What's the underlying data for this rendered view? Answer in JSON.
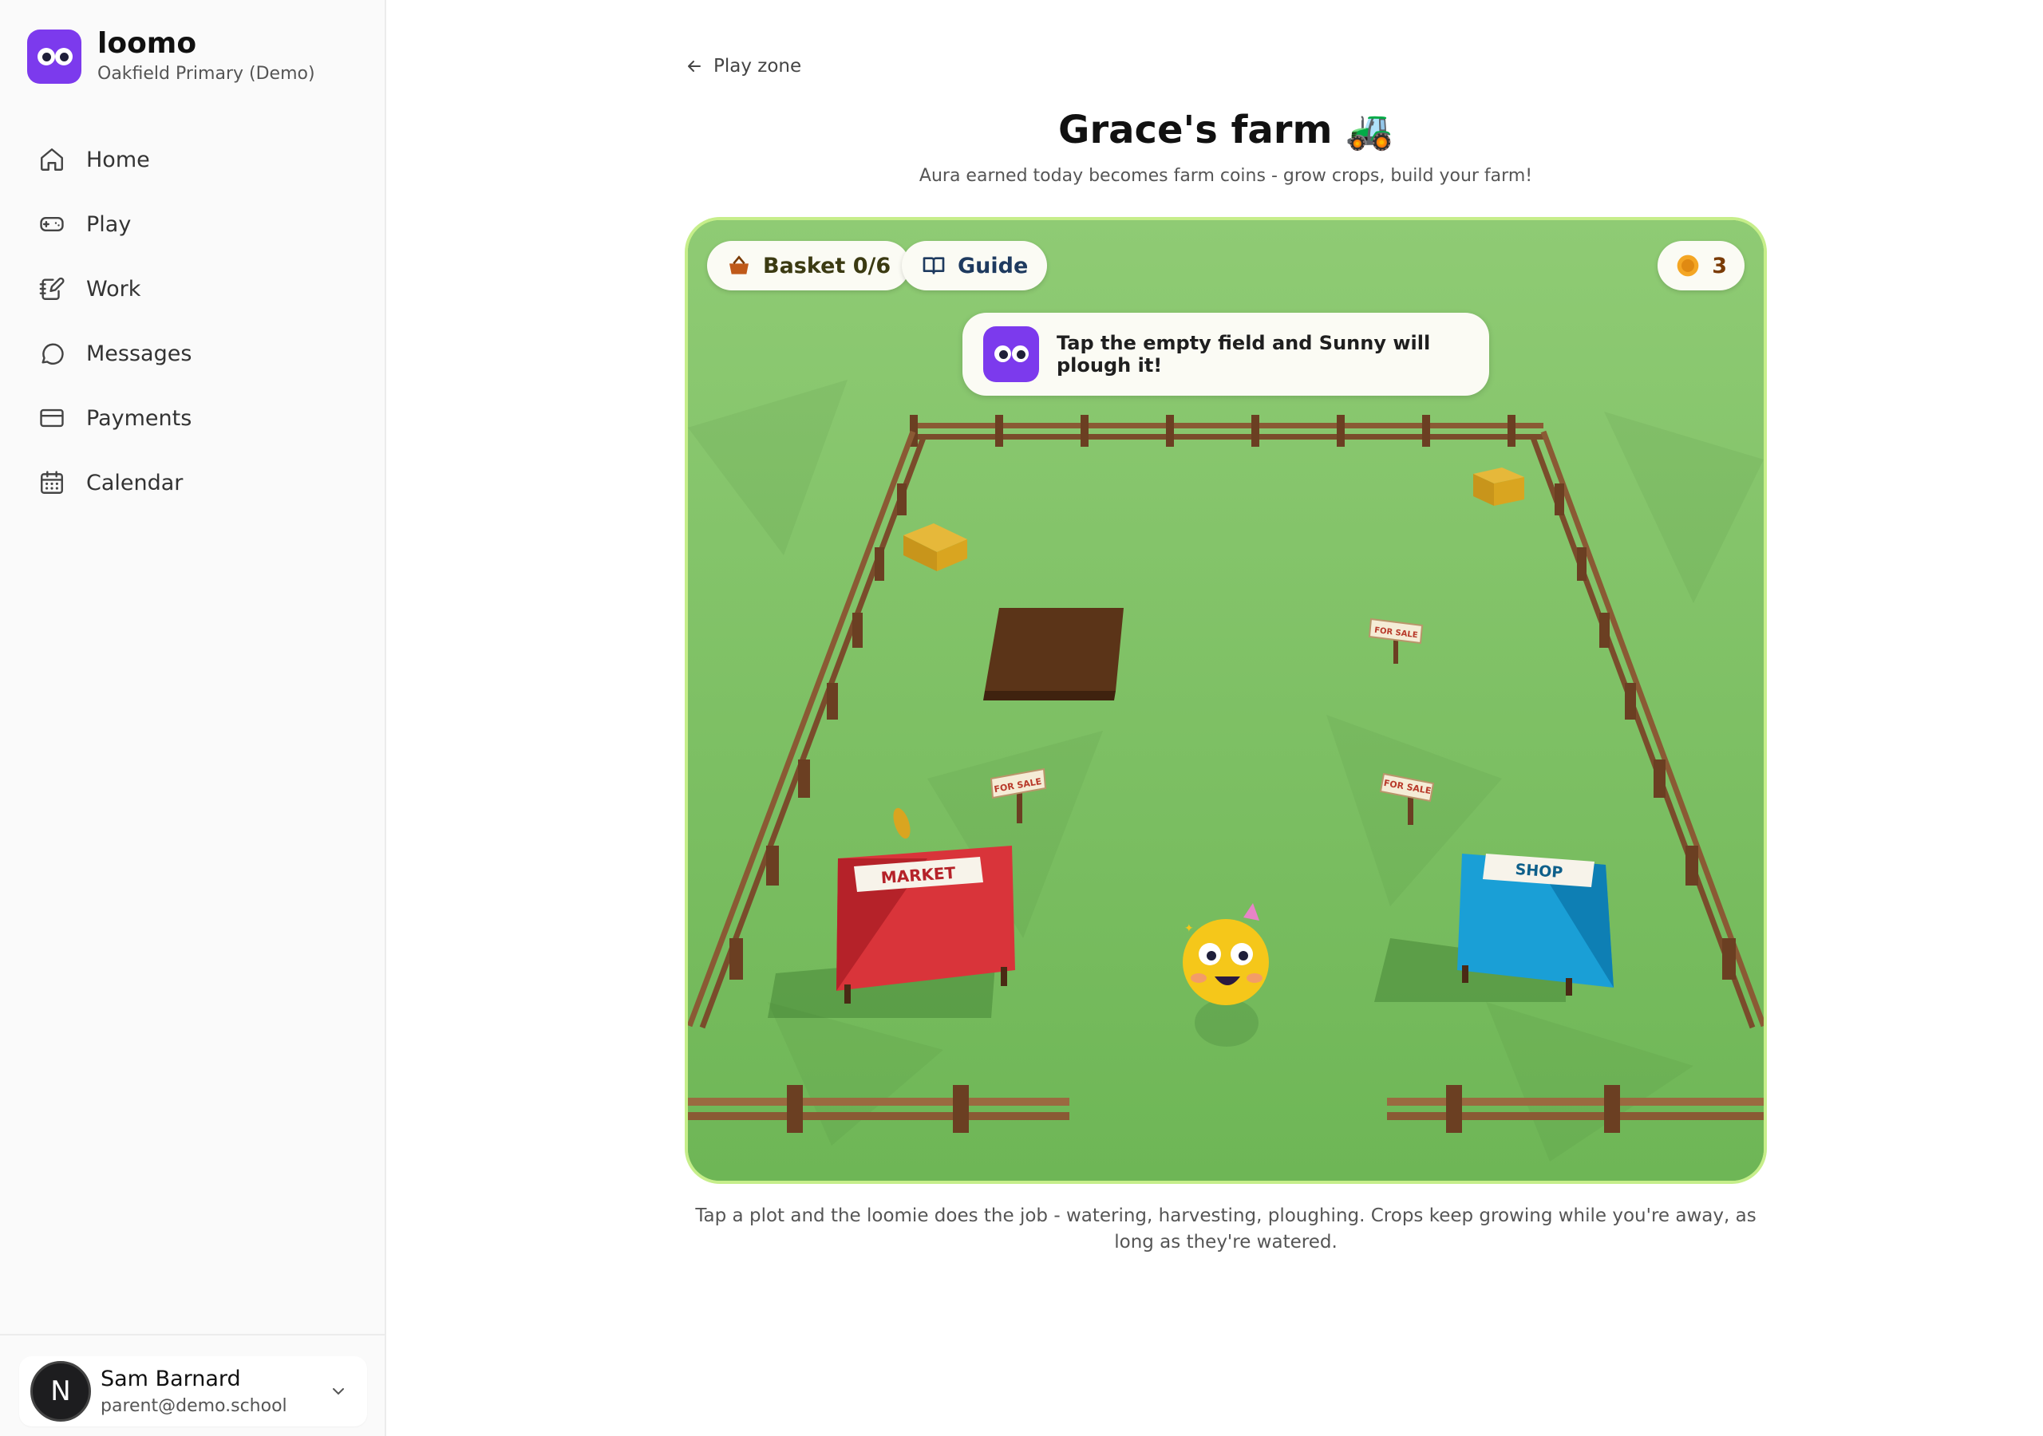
{
  "brand": {
    "name": "loomo",
    "school": "Oakfield Primary (Demo)"
  },
  "nav": {
    "home": "Home",
    "play": "Play",
    "work": "Work",
    "messages": "Messages",
    "payments": "Payments",
    "calendar": "Calendar"
  },
  "user": {
    "initial": "N",
    "name": "Sam Barnard",
    "email": "parent@demo.school"
  },
  "page": {
    "back_label": "Play zone",
    "title": "Grace's farm 🚜",
    "subtitle": "Aura earned today becomes farm coins - grow crops, build your farm!",
    "caption": "Tap a plot and the loomie does the job - watering, harvesting, ploughing. Crops keep growing while you're away, as long as they're watered."
  },
  "game": {
    "basket_label": "Basket 0/6",
    "guide_label": "Guide",
    "coins": "3",
    "hint": "Tap the empty field and Sunny will plough it!",
    "market_label": "MARKET",
    "shop_label": "SHOP",
    "for_sale_label": "FOR SALE",
    "colors": {
      "grass": "#6db553",
      "fence": "#8a5a34",
      "market": "#d9343a",
      "shop": "#1a9fd6",
      "soil": "#5b3418",
      "hay": "#d9a520"
    }
  }
}
